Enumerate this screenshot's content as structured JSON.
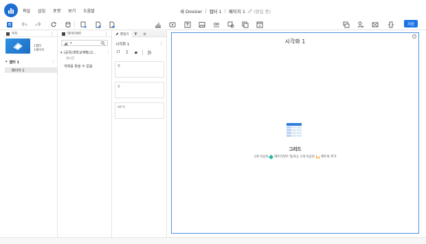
{
  "menu": {
    "items": [
      "파일",
      "삽입",
      "포맷",
      "보기",
      "도움말"
    ]
  },
  "title": {
    "dossier": "새 Dossier",
    "chapter": "챕터 1",
    "page": "페이지 1",
    "status": "(편집 중)"
  },
  "toolbar": {
    "save_label": "저장",
    "accent": "#1a73e8"
  },
  "toc_panel": {
    "title": "목차",
    "meta_line1": "1챕터",
    "meta_line2": "1페이지",
    "chapter_label": "챕터 1",
    "page_label": "페이지 1"
  },
  "dataset_panel": {
    "title": "데이터세트",
    "item_label": "(공유)대학교계획(고...",
    "item_sub": "실시간",
    "empty_text": "개체를 찾을 수 없음"
  },
  "editor_panel": {
    "tab_editor": "편집기",
    "viz_title": "시각화 1",
    "zone_rows": "행",
    "zone_cols": "열",
    "zone_metrics": "메트릭"
  },
  "canvas": {
    "viz_title": "시각화 1",
    "viz_name": "그리드",
    "hint_pre": "1개 이상의",
    "hint_mid1": "애트리뷰트 및/또는 1개 이상의",
    "hint_mid2": "메트릭 추가",
    "border_color": "#4a90e2"
  }
}
